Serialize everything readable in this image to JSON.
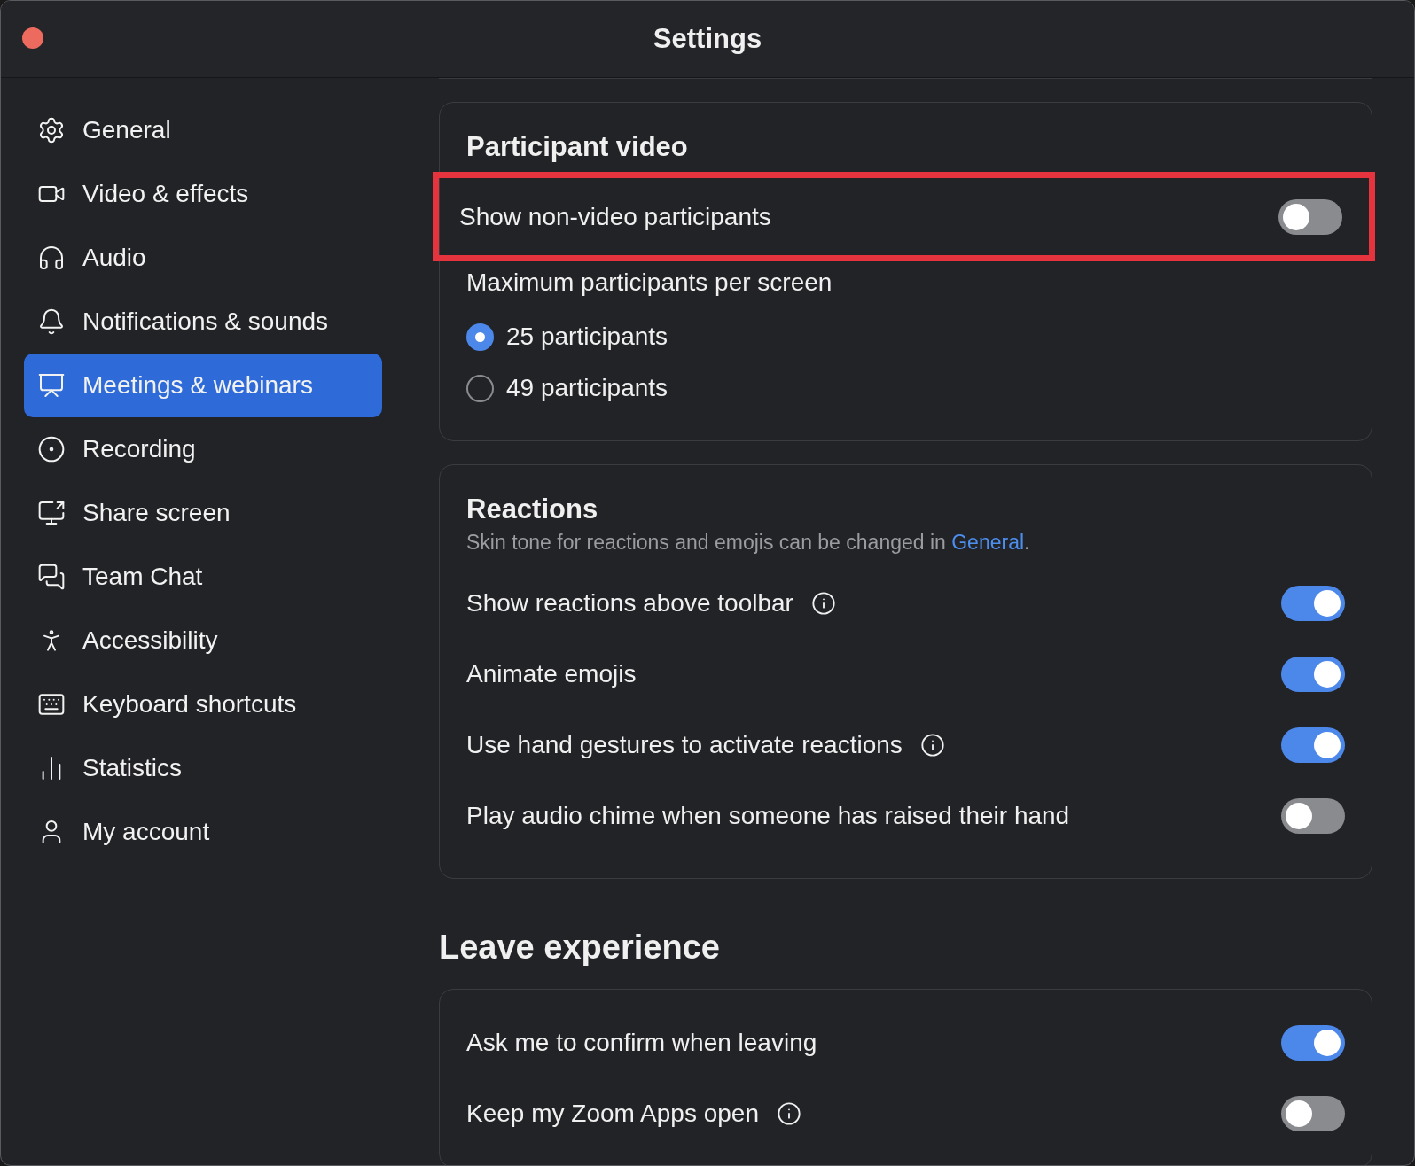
{
  "window": {
    "title": "Settings"
  },
  "sidebar": {
    "items": [
      {
        "label": "General",
        "selected": false
      },
      {
        "label": "Video & effects",
        "selected": false
      },
      {
        "label": "Audio",
        "selected": false
      },
      {
        "label": "Notifications & sounds",
        "selected": false
      },
      {
        "label": "Meetings & webinars",
        "selected": true
      },
      {
        "label": "Recording",
        "selected": false
      },
      {
        "label": "Share screen",
        "selected": false
      },
      {
        "label": "Team Chat",
        "selected": false
      },
      {
        "label": "Accessibility",
        "selected": false
      },
      {
        "label": "Keyboard shortcuts",
        "selected": false
      },
      {
        "label": "Statistics",
        "selected": false
      },
      {
        "label": "My account",
        "selected": false
      }
    ]
  },
  "sections": [
    {
      "kind": "card",
      "title": "Participant video",
      "rows": [
        {
          "kind": "toggle",
          "label": "Show non-video participants",
          "on": false,
          "info": false,
          "highlighted": true
        },
        {
          "kind": "radio_group",
          "label": "Maximum participants per screen",
          "options": [
            {
              "label": "25 participants",
              "selected": true
            },
            {
              "label": "49 participants",
              "selected": false
            }
          ]
        }
      ]
    },
    {
      "kind": "card",
      "title": "Reactions",
      "note": {
        "text": "Skin tone for reactions and emojis can be changed in ",
        "link": "General",
        "after": "."
      },
      "rows": [
        {
          "kind": "toggle",
          "label": "Show reactions above toolbar",
          "on": true,
          "info": true,
          "highlighted": false
        },
        {
          "kind": "toggle",
          "label": "Animate emojis",
          "on": true,
          "info": false,
          "highlighted": false
        },
        {
          "kind": "toggle",
          "label": "Use hand gestures to activate reactions",
          "on": true,
          "info": true,
          "highlighted": false
        },
        {
          "kind": "toggle",
          "label": "Play audio chime when someone has raised their hand",
          "on": false,
          "info": false,
          "highlighted": false
        }
      ]
    },
    {
      "kind": "heading",
      "title": "Leave experience"
    },
    {
      "kind": "card",
      "rows": [
        {
          "kind": "toggle",
          "label": "Ask me to confirm when leaving",
          "on": true,
          "info": false,
          "highlighted": false
        },
        {
          "kind": "toggle",
          "label": "Keep my Zoom Apps open",
          "on": false,
          "info": true,
          "highlighted": false
        }
      ]
    }
  ]
}
